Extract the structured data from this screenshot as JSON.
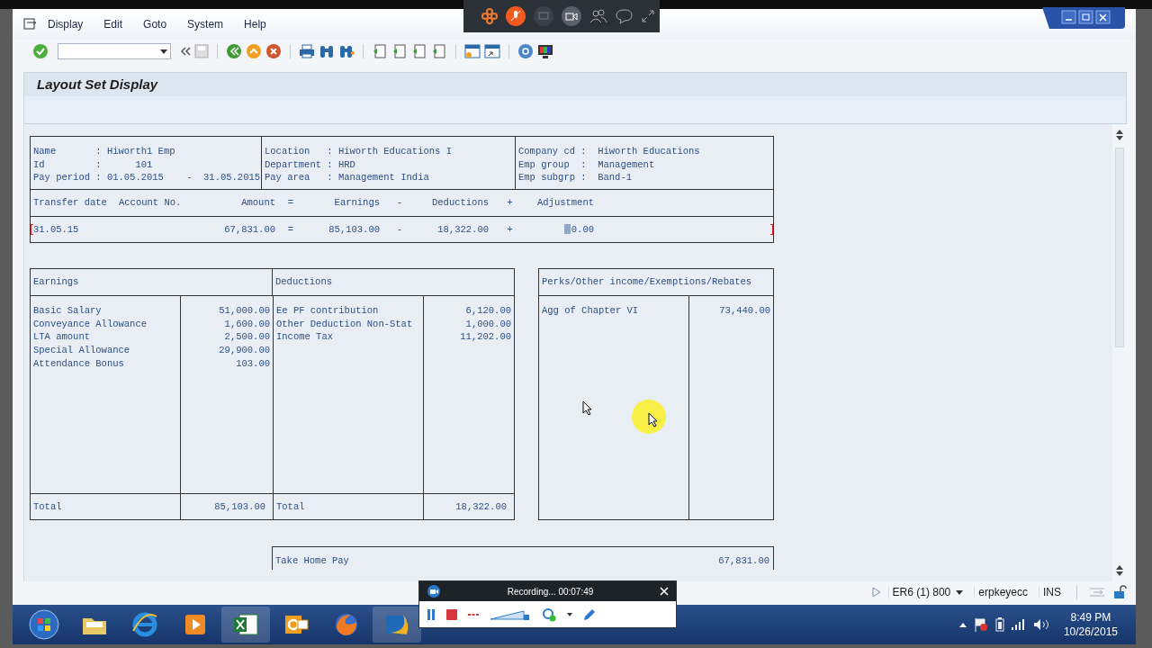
{
  "menu": [
    {
      "label": "Display"
    },
    {
      "label": "Edit"
    },
    {
      "label": "Goto"
    },
    {
      "label": "System"
    },
    {
      "label": "Help"
    }
  ],
  "title": "Layout Set Display",
  "header": {
    "columns": [
      {
        "lines": [
          "Name       : Hiworth1 Emp",
          "Id         :      101",
          "Pay period : 01.05.2015    -  31.05.2015"
        ]
      },
      {
        "lines": [
          "Location   : Hiworth Educations I",
          "Department : HRD",
          "Pay area   : Management India"
        ]
      },
      {
        "lines": [
          "Company cd :  Hiworth Educations",
          "Emp group  :  Management",
          "Emp subgrp :  Band-1"
        ]
      }
    ]
  },
  "payment": {
    "headers": [
      "Transfer date",
      "Account No.",
      "Amount",
      "=",
      "Earnings",
      "-",
      "Deductions",
      "+",
      "Adjustment"
    ],
    "values": [
      "31.05.15",
      "67,831.00",
      "=",
      "85,103.00",
      "-",
      "18,322.00",
      "+",
      "0.00"
    ]
  },
  "earnings": {
    "title": "Earnings",
    "items": [
      {
        "label": "Basic Salary",
        "amount": "51,000.00"
      },
      {
        "label": "Conveyance Allowance",
        "amount": "1,600.00"
      },
      {
        "label": "LTA amount",
        "amount": "2,500.00"
      },
      {
        "label": "Special Allowance",
        "amount": "29,900.00"
      },
      {
        "label": "Attendance Bonus",
        "amount": "103.00"
      }
    ],
    "total_label": "Total",
    "total": "85,103.00"
  },
  "deductions": {
    "title": "Deductions",
    "items": [
      {
        "label": "Ee PF contribution",
        "amount": "6,120.00"
      },
      {
        "label": "Other Deduction Non-Stat",
        "amount": "1,000.00"
      },
      {
        "label": "Income Tax",
        "amount": "11,202.00"
      }
    ],
    "total_label": "Total",
    "total": "18,322.00"
  },
  "perks": {
    "title": "Perks/Other income/Exemptions/Rebates",
    "items": [
      {
        "label": "Agg of Chapter VI",
        "amount": "73,440.00"
      }
    ]
  },
  "take_home": {
    "label": "Take Home Pay",
    "amount": "67,831.00"
  },
  "status_bar": {
    "system": "ER6 (1) 800",
    "user": "erpkeyecc",
    "mode": "INS"
  },
  "taskbar": {
    "time": "8:49 PM",
    "date": "10/26/2015"
  },
  "recorder": {
    "status": "Recording... 00:07:49"
  }
}
